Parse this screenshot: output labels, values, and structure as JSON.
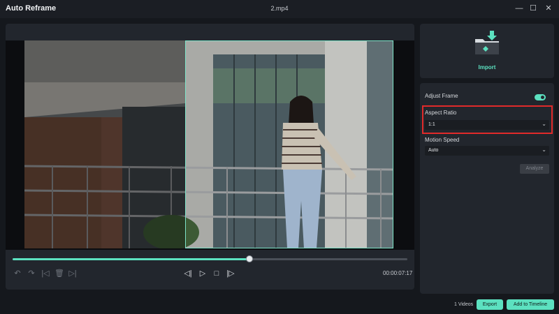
{
  "window": {
    "app_title": "Auto Reframe",
    "file_title": "2.mp4",
    "minimize_glyph": "—",
    "maximize_glyph": "☐",
    "close_glyph": "✕"
  },
  "player": {
    "progress": 0.6,
    "timecode": "00:00:07:17",
    "controls": {
      "undo": "↶",
      "redo": "↷",
      "mark_in": "|◁",
      "delete": "🗑",
      "mark_out": "▷|",
      "prev_frame": "◁|",
      "play": "▷",
      "stop": "□",
      "next_frame": "|▷"
    }
  },
  "import": {
    "label": "Import",
    "icon": "folder-import-icon"
  },
  "settings": {
    "adjust_frame_label": "Adjust Frame",
    "adjust_frame_on": true,
    "aspect_ratio_label": "Aspect Ratio",
    "aspect_ratio_value": "1:1",
    "motion_speed_label": "Motion Speed",
    "motion_speed_value": "Auto",
    "analyze_label": "Analyze",
    "caret": "⌄"
  },
  "footer": {
    "videos_count": "1 Videos",
    "export_label": "Export",
    "add_to_timeline_label": "Add to Timeline"
  },
  "colors": {
    "accent": "#5ce1c0",
    "highlight": "#e12a2a",
    "panel": "#22262d",
    "background": "#15181d"
  }
}
